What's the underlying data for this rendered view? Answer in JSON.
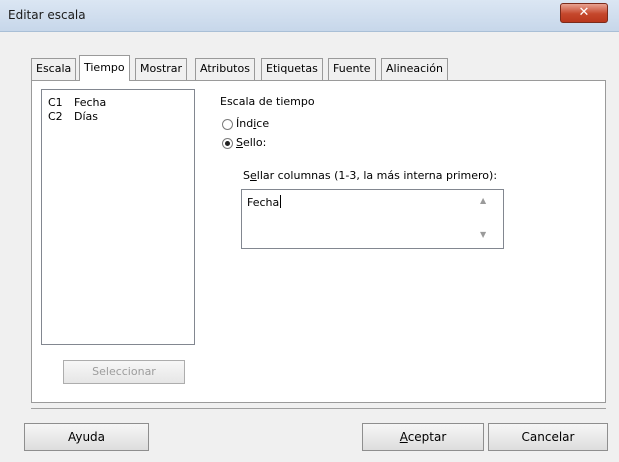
{
  "window": {
    "title": "Editar escala",
    "close_symbol": "✕"
  },
  "tabs": [
    {
      "label": "Escala",
      "active": false
    },
    {
      "label": "Tiempo",
      "active": true
    },
    {
      "label": "Mostrar",
      "active": false
    },
    {
      "label": "Atributos",
      "active": false
    },
    {
      "label": "Etiquetas",
      "active": false
    },
    {
      "label": "Fuente",
      "active": false
    },
    {
      "label": "Alineación",
      "active": false
    }
  ],
  "columns": [
    {
      "id": "C1",
      "name": "Fecha"
    },
    {
      "id": "C2",
      "name": "Días"
    }
  ],
  "select_button": "Seleccionar",
  "time_scale": {
    "label": "Escala de tiempo",
    "options": [
      {
        "label_pre": "Índ",
        "label_ul": "i",
        "label_post": "ce",
        "checked": false
      },
      {
        "label_pre": "",
        "label_ul": "S",
        "label_post": "ello:",
        "checked": true
      }
    ]
  },
  "stamp_columns": {
    "label_pre": "S",
    "label_ul": "e",
    "label_post": "llar columnas (1-3, la más interna primero):",
    "value": "Fecha"
  },
  "buttons": {
    "help": "Ayuda",
    "ok_ul": "A",
    "ok_rest": "ceptar",
    "cancel": "Cancelar"
  }
}
